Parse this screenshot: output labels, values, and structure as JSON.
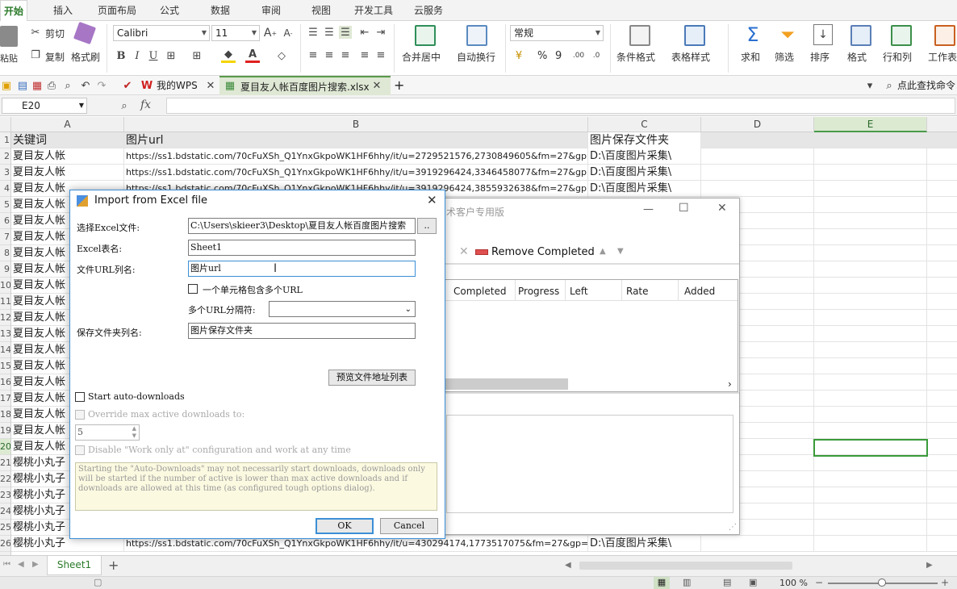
{
  "ribbon_tabs": [
    "开始",
    "插入",
    "页面布局",
    "公式",
    "数据",
    "审阅",
    "视图",
    "开发工具",
    "云服务"
  ],
  "ribbon": {
    "paste": "粘贴",
    "cut": "剪切",
    "copy": "复制",
    "format_painter": "格式刷",
    "font_name": "Calibri",
    "font_size": "11",
    "merge_center": "合并居中",
    "wrap_text": "自动换行",
    "number_format": "常规",
    "percent": "%",
    "comma": "9",
    "conditional_format": "条件格式",
    "table_style": "表格样式",
    "sum": "求和",
    "filter": "筛选",
    "sort": "排序",
    "format": "格式",
    "row_col": "行和列",
    "worksheet": "工作表"
  },
  "quick_access": {
    "my_wps": "我的WPS",
    "doc_name": "夏目友人帐百度图片搜索.xlsx",
    "add_tab": "+",
    "search_cmd": "点此查找命令"
  },
  "formula_bar": {
    "cell_ref": "E20",
    "fx": "fx"
  },
  "columns": [
    "A",
    "B",
    "C",
    "D",
    "E"
  ],
  "row_numbers": [
    "1",
    "2",
    "3",
    "4",
    "5",
    "6",
    "7",
    "8",
    "9",
    "10",
    "11",
    "12",
    "13",
    "14",
    "15",
    "16",
    "17",
    "18",
    "19",
    "20",
    "21",
    "22",
    "23",
    "24",
    "25",
    "26"
  ],
  "header_row": {
    "a": "关键词",
    "b": "图片url",
    "c": "图片保存文件夹"
  },
  "rows": [
    {
      "a": "夏目友人帐",
      "b": "https://ss1.bdstatic.com/70cFuXSh_Q1YnxGkpoWK1HF6hhy/it/u=2729521576,2730849605&fm=27&gp=0.jpg",
      "c": "D:\\百度图片采集\\"
    },
    {
      "a": "夏目友人帐",
      "b": "https://ss1.bdstatic.com/70cFuXSh_Q1YnxGkpoWK1HF6hhy/it/u=3919296424,3346458077&fm=27&gp=0.jpg",
      "c": "D:\\百度图片采集\\"
    },
    {
      "a": "夏目友人帐",
      "b": "https://ss1.bdstatic.com/70cFuXSh_Q1YnxGkpoWK1HF6hhy/it/u=3919296424,3855932638&fm=27&gp=0.jpg",
      "c": "D:\\百度图片采集\\"
    },
    {
      "a": "夏目友人帐",
      "b": "",
      "c": ""
    },
    {
      "a": "夏目友人帐",
      "b": "",
      "c": ""
    },
    {
      "a": "夏目友人帐",
      "b": "",
      "c": ""
    },
    {
      "a": "夏目友人帐",
      "b": "",
      "c": ""
    },
    {
      "a": "夏目友人帐",
      "b": "",
      "c": ""
    },
    {
      "a": "夏目友人帐",
      "b": "",
      "c": ""
    },
    {
      "a": "夏目友人帐",
      "b": "",
      "c": ""
    },
    {
      "a": "夏目友人帐",
      "b": "",
      "c": ""
    },
    {
      "a": "夏目友人帐",
      "b": "",
      "c": ""
    },
    {
      "a": "夏目友人帐",
      "b": "",
      "c": ""
    },
    {
      "a": "夏目友人帐",
      "b": "",
      "c": ""
    },
    {
      "a": "夏目友人帐",
      "b": "",
      "c": ""
    },
    {
      "a": "夏目友人帐",
      "b": "",
      "c": ""
    },
    {
      "a": "夏目友人帐",
      "b": "",
      "c": ""
    },
    {
      "a": "夏目友人帐",
      "b": "",
      "c": ""
    },
    {
      "a": "夏目友人帐",
      "b": "",
      "c": ""
    },
    {
      "a": "樱桃小丸子",
      "b": "",
      "c": ""
    },
    {
      "a": "樱桃小丸子",
      "b": "",
      "c": ""
    },
    {
      "a": "樱桃小丸子",
      "b": "",
      "c": ""
    },
    {
      "a": "樱桃小丸子",
      "b": "",
      "c": ""
    },
    {
      "a": "樱桃小丸子",
      "b": "",
      "c": ""
    },
    {
      "a": "樱桃小丸子",
      "b": "https://ss1.bdstatic.com/70cFuXSh_Q1YnxGkpoWK1HF6hhy/it/u=430294174,1773517075&fm=27&gp=0.jpg",
      "c": "D:\\百度图片采集\\"
    }
  ],
  "sheet_tab": "Sheet1",
  "status": {
    "zoom": "100 %"
  },
  "bg_window": {
    "title": "术客户专用版",
    "remove_completed": "Remove Completed",
    "columns": [
      "Completed",
      "Progress",
      "Left",
      "Rate",
      "Added"
    ]
  },
  "dialog": {
    "title": "Import from Excel file",
    "excel_file_label": "选择Excel文件:",
    "excel_file_value": "C:\\Users\\skieer3\\Desktop\\夏目友人帐百度图片搜索",
    "browse": "..",
    "sheet_label": "Excel表名:",
    "sheet_value": "Sheet1",
    "url_col_label": "文件URL列名:",
    "url_col_value": "图片url",
    "multi_url_check": "一个单元格包含多个URL",
    "separator_label": "多个URL分隔符:",
    "separator_value": "",
    "folder_col_label": "保存文件夹列名:",
    "folder_col_value": "图片保存文件夹",
    "preview_btn": "预览文件地址列表",
    "auto_downloads": "Start auto-downloads",
    "override_max": "Override max active downloads to:",
    "max_value": "5",
    "disable_work": "Disable \"Work only at\" configuration and work at any time",
    "note": "Starting the \"Auto-Downloads\" may not necessarily start downloads, downloads only will be started if the number of active is lower than max active downloads and if downloads are allowed at this time (as configured tough options dialog).",
    "ok": "OK",
    "cancel": "Cancel"
  }
}
